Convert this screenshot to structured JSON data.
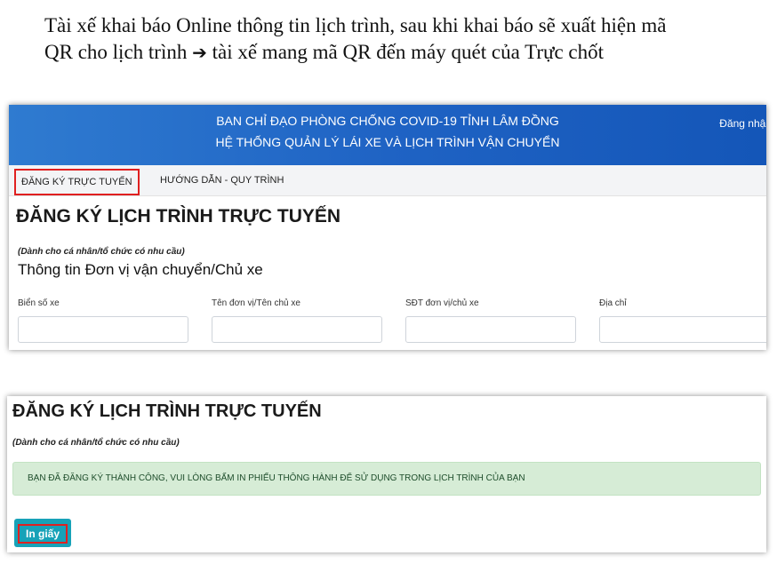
{
  "intro": {
    "line1": "Tài xế khai báo Online thông tin lịch trình, sau khi khai báo sẽ xuất hiện mã",
    "line2_start": "QR cho lịch trình",
    "arrow": "➔",
    "line2_end": "tài xế mang mã QR đến máy quét của Trực chốt"
  },
  "header": {
    "line1": "BAN CHỈ ĐẠO PHÒNG CHỐNG COVID-19 TỈNH LÂM ĐỒNG",
    "line2": "HỆ THỐNG QUẢN LÝ LÁI XE VÀ LỊCH TRÌNH VẬN CHUYỂN",
    "login": "Đăng nhập"
  },
  "nav": {
    "items": [
      {
        "label": "ĐĂNG KÝ TRỰC TUYẾN",
        "active": true
      },
      {
        "label": "HƯỚNG DẪN - QUY TRÌNH",
        "active": false
      }
    ]
  },
  "form": {
    "title": "ĐĂNG KÝ LỊCH TRÌNH TRỰC TUYẾN",
    "subtitle": "(Dành cho cá nhân/tổ chức có nhu cầu)",
    "section_title": "Thông tin Đơn vị vận chuyển/Chủ xe",
    "fields": [
      {
        "label": "Biển số xe",
        "value": ""
      },
      {
        "label": "Tên đơn vị/Tên chủ xe",
        "value": ""
      },
      {
        "label": "SĐT đơn vị/chủ xe",
        "value": ""
      },
      {
        "label": "Địa chỉ",
        "value": ""
      }
    ]
  },
  "result": {
    "title": "ĐĂNG KÝ LỊCH TRÌNH TRỰC TUYẾN",
    "subtitle": "(Dành cho cá nhân/tổ chức có nhu cầu)",
    "success_message": "BẠN ĐÃ ĐĂNG KÝ THÀNH CÔNG, VUI LÒNG BẤM IN PHIẾU THÔNG HÀNH ĐỂ SỬ DỤNG TRONG LỊCH TRÌNH CỦA BẠN",
    "print_label": "In giấy"
  },
  "colors": {
    "header_blue": "#1f63c4",
    "highlight_red": "#e02020",
    "print_teal": "#17a2b8",
    "success_green": "#d6ecd6"
  }
}
